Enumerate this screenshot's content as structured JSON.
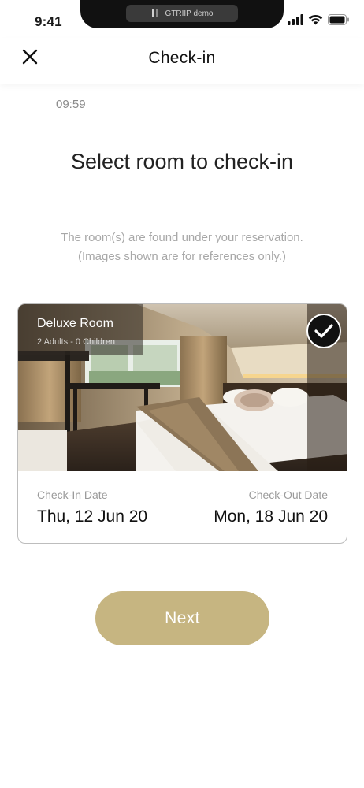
{
  "status_bar": {
    "time": "9:41",
    "notch_label": "GTRIIP demo"
  },
  "header": {
    "title": "Check-in",
    "close_icon": "close-icon"
  },
  "timer": "09:59",
  "page": {
    "title": "Select room to check-in",
    "subtitle_line1": "The room(s) are found under your reservation.",
    "subtitle_line2": "(Images shown are for references only.)"
  },
  "room": {
    "name": "Deluxe Room",
    "guests": "2 Adults - 0 Children",
    "selected": true,
    "check_in_label": "Check-In Date",
    "check_in_value": "Thu, 12 Jun 20",
    "check_out_label": "Check-Out Date",
    "check_out_value": "Mon, 18 Jun 20"
  },
  "next_button": {
    "label": "Next"
  },
  "colors": {
    "accent": "#c6b581",
    "text": "#111111",
    "muted": "#a8a8a8"
  }
}
